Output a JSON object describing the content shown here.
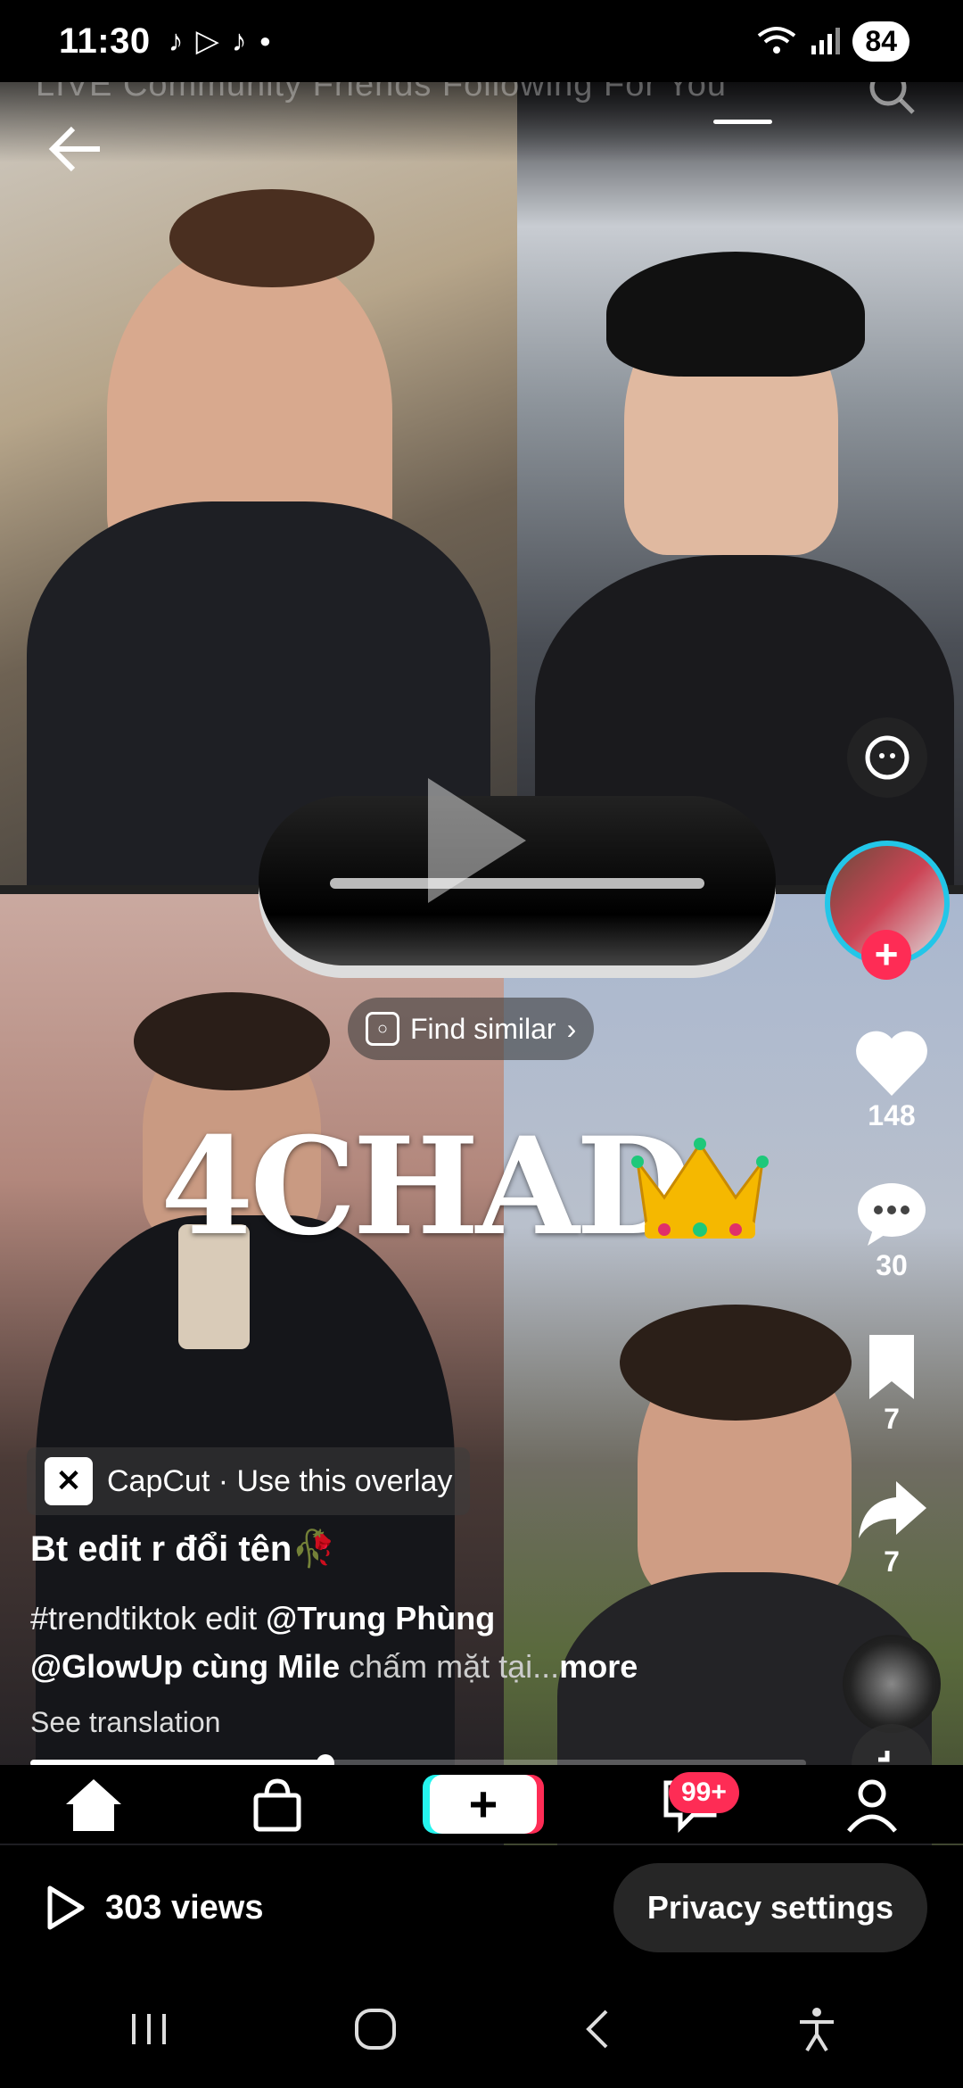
{
  "status_bar": {
    "time": "11:30",
    "battery": "84",
    "notification_icons": [
      "tiktok-icon",
      "play-store-icon",
      "tiktok-icon",
      "dot-icon"
    ]
  },
  "top_tabs": "LIVE   Community   Friends   Following   For You",
  "find_similar": "Find similar",
  "overlay_text": "4CHAD",
  "right_rail": {
    "likes": "148",
    "comments": "30",
    "saves": "7",
    "shares": "7"
  },
  "caption": {
    "capcut_label": "CapCut · Use this overlay",
    "title": "Bt edit r đổi tên🥀",
    "desc_tags": "#trendtiktok edit",
    "mention1": "@Trung Phùng",
    "mention2": "@GlowUp cùng Mile",
    "desc_tail": " chấm mặt tại...",
    "more": "more",
    "see_translation": "See translation"
  },
  "playback_progress": 0.38,
  "bottom_nav": {
    "items": [
      "home-icon",
      "shop-icon",
      "create-button",
      "inbox-icon",
      "profile-icon"
    ],
    "inbox_badge": "99+"
  },
  "views_bar": {
    "views": "303 views",
    "privacy": "Privacy settings"
  },
  "colors": {
    "accent_red": "#fe2c55",
    "accent_cyan": "#25f4ee"
  }
}
